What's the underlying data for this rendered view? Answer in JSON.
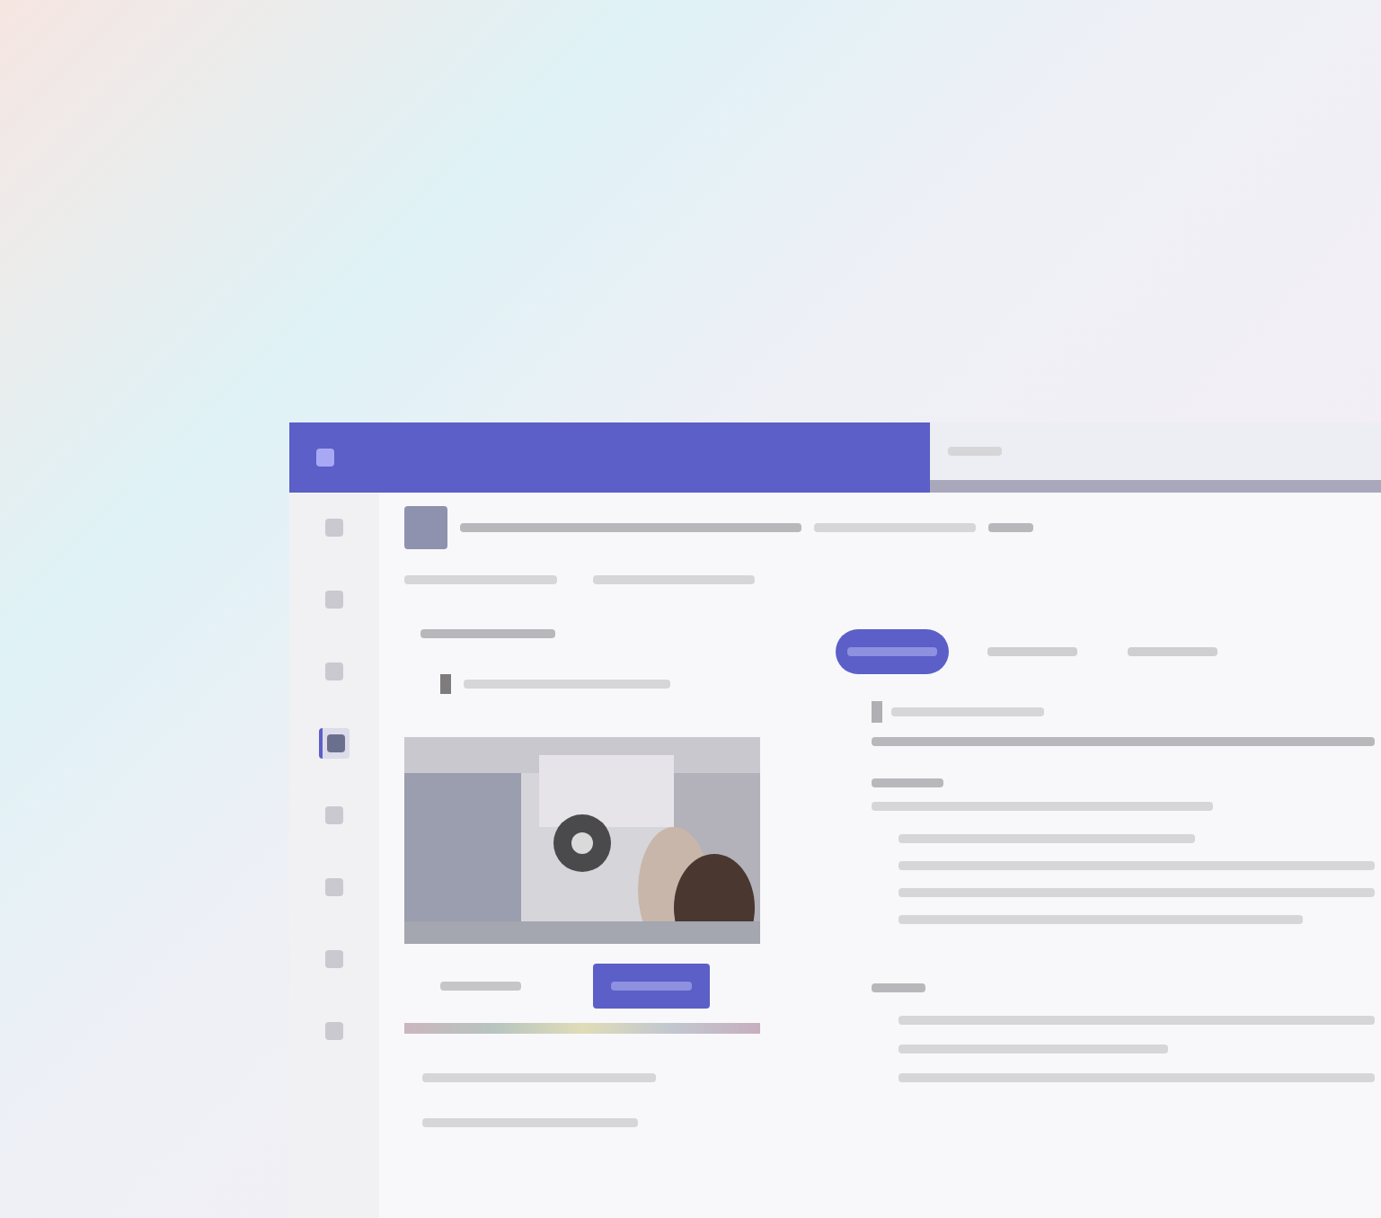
{
  "rail": [
    {
      "selected": false
    },
    {
      "selected": false
    },
    {
      "selected": false
    },
    {
      "selected": true
    },
    {
      "selected": false
    },
    {
      "selected": false
    },
    {
      "selected": false
    },
    {
      "selected": false
    }
  ],
  "tabs": [
    {
      "selected": true
    },
    {
      "selected": false
    },
    {
      "selected": false
    }
  ],
  "view_buttons": [
    {
      "selected": false
    },
    {
      "selected": true
    }
  ]
}
